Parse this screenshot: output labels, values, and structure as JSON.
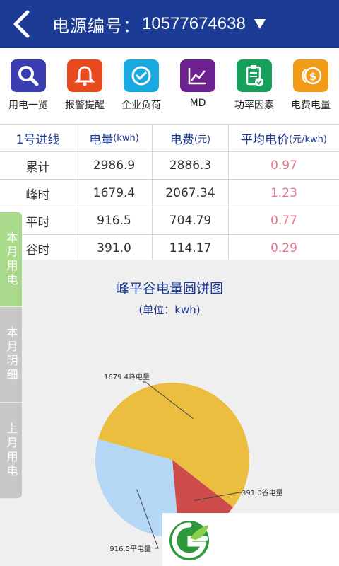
{
  "header": {
    "title_label": "电源编号：",
    "title_value": "10577674638"
  },
  "nav": [
    {
      "label": "用电一览",
      "icon": "search-icon",
      "color": "#3a3db0"
    },
    {
      "label": "报警提醒",
      "icon": "bell-icon",
      "color": "#e8491d"
    },
    {
      "label": "企业负荷",
      "icon": "check-icon",
      "color": "#18a9e0"
    },
    {
      "label": "MD",
      "icon": "line-chart-icon",
      "color": "#6d2190"
    },
    {
      "label": "功率因素",
      "icon": "document-icon",
      "color": "#16a05a"
    },
    {
      "label": "电费电量",
      "icon": "coin-icon",
      "color": "#f29b16"
    }
  ],
  "table": {
    "headers": {
      "line": "1号进线",
      "energy": "电量",
      "energy_unit": "(kwh)",
      "fee": "电费",
      "fee_unit": "(元)",
      "avg": "平均电价",
      "avg_unit": "(元/kwh)"
    },
    "rows": [
      {
        "label": "累计",
        "energy": "2986.9",
        "fee": "2886.3",
        "avg": "0.97"
      },
      {
        "label": "峰时",
        "energy": "1679.4",
        "fee": "2067.34",
        "avg": "1.23"
      },
      {
        "label": "平时",
        "energy": "916.5",
        "fee": "704.79",
        "avg": "0.77"
      },
      {
        "label": "谷时",
        "energy": "391.0",
        "fee": "114.17",
        "avg": "0.29"
      }
    ]
  },
  "side_tabs": [
    "本月用电",
    "本月明细",
    "上月用电"
  ],
  "chart": {
    "title": "峰平谷电量圆饼图",
    "subtitle": "(单位：kwh)"
  },
  "chart_data": {
    "type": "pie",
    "slices": [
      {
        "label": "1679.4峰电量",
        "value": 1679.4,
        "color": "#ebbe40"
      },
      {
        "label": "391.0谷电量",
        "value": 391.0,
        "color": "#cd4c49"
      },
      {
        "label": "916.5平电量",
        "value": 916.5,
        "color": "#b3d7f5"
      }
    ]
  }
}
